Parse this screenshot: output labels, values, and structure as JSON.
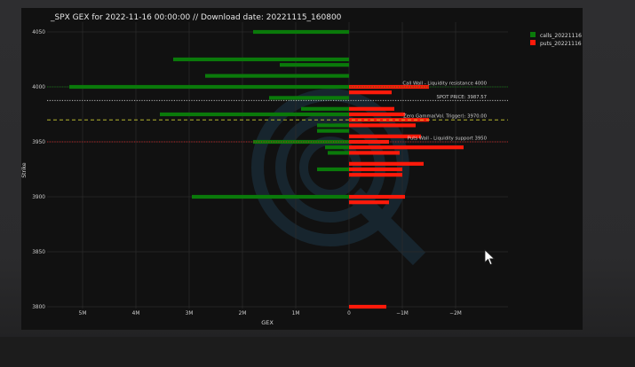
{
  "chart_data": {
    "type": "bar",
    "orientation": "horizontal",
    "title": "_SPX GEX for 2022-11-16 00:00:00 // Download date: 20221115_160800",
    "xlabel": "GEX",
    "ylabel": "Strike",
    "xlim": [
      5.5,
      -2.3
    ],
    "ylim": [
      3795,
      4055
    ],
    "x_ticks": [
      {
        "value": 5,
        "label": "5M"
      },
      {
        "value": 4,
        "label": "4M"
      },
      {
        "value": 3,
        "label": "3M"
      },
      {
        "value": 2,
        "label": "2M"
      },
      {
        "value": 1,
        "label": "1M"
      },
      {
        "value": 0,
        "label": "0"
      },
      {
        "value": -1,
        "label": "−1M"
      },
      {
        "value": -2,
        "label": "−2M"
      }
    ],
    "y_ticks": [
      {
        "value": 4050,
        "label": "4050"
      },
      {
        "value": 4000,
        "label": "4000"
      },
      {
        "value": 3950,
        "label": "3950"
      },
      {
        "value": 3900,
        "label": "3900"
      },
      {
        "value": 3850,
        "label": "3850"
      },
      {
        "value": 3800,
        "label": "3800"
      }
    ],
    "grid": true,
    "legend_position": "top-right",
    "series": [
      {
        "name": "calls_20221116",
        "color": "#0a7a0a",
        "points": [
          {
            "strike": 4050,
            "value": 1.8
          },
          {
            "strike": 4025,
            "value": 3.3
          },
          {
            "strike": 4020,
            "value": 1.3
          },
          {
            "strike": 4010,
            "value": 2.7
          },
          {
            "strike": 4000,
            "value": 5.25
          },
          {
            "strike": 3990,
            "value": 1.5
          },
          {
            "strike": 3980,
            "value": 0.9
          },
          {
            "strike": 3975,
            "value": 3.55
          },
          {
            "strike": 3965,
            "value": 0.6
          },
          {
            "strike": 3960,
            "value": 0.6
          },
          {
            "strike": 3950,
            "value": 1.8
          },
          {
            "strike": 3945,
            "value": 0.45
          },
          {
            "strike": 3940,
            "value": 0.4
          },
          {
            "strike": 3925,
            "value": 0.6
          },
          {
            "strike": 3900,
            "value": 2.95
          }
        ]
      },
      {
        "name": "puts_20221116",
        "color": "#ff1a0a",
        "points": [
          {
            "strike": 4000,
            "value": -1.5
          },
          {
            "strike": 3995,
            "value": -0.8
          },
          {
            "strike": 3980,
            "value": -0.85
          },
          {
            "strike": 3975,
            "value": -1.05
          },
          {
            "strike": 3970,
            "value": -1.5
          },
          {
            "strike": 3965,
            "value": -1.25
          },
          {
            "strike": 3955,
            "value": -1.35
          },
          {
            "strike": 3950,
            "value": -0.75
          },
          {
            "strike": 3945,
            "value": -2.15
          },
          {
            "strike": 3940,
            "value": -0.95
          },
          {
            "strike": 3930,
            "value": -1.4
          },
          {
            "strike": 3925,
            "value": -1.0
          },
          {
            "strike": 3920,
            "value": -1.0
          },
          {
            "strike": 3900,
            "value": -1.05
          },
          {
            "strike": 3895,
            "value": -0.75
          },
          {
            "strike": 3800,
            "value": -0.7
          }
        ]
      }
    ],
    "annotations": [
      {
        "strike": 4000,
        "text": "Call Wall - Liquidity resistance 4000",
        "color": "#d0d0d0",
        "line_color": "#0a7a0a",
        "line_style": "dotted"
      },
      {
        "strike": 3987.57,
        "text": "SPOT PRICE: 3987.57",
        "color": "#d0d0d0",
        "line_color": "#cfcfcf",
        "line_style": "dotted"
      },
      {
        "strike": 3970,
        "text": "Zero Gamma(Vol. Trigger): 3970.00",
        "color": "#d0d0d0",
        "line_color": "#c8c832",
        "line_style": "dashed"
      },
      {
        "strike": 3950,
        "text": "Puts Wall - Liquidity support 3950",
        "color": "#d0d0d0",
        "line_color": "#cc2222",
        "line_style": "dotted"
      }
    ]
  }
}
